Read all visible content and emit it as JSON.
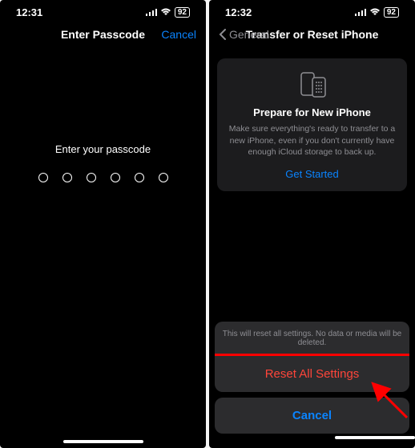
{
  "left": {
    "time": "12:31",
    "battery": "92",
    "title": "Enter Passcode",
    "cancel": "Cancel",
    "prompt": "Enter your passcode"
  },
  "right": {
    "time": "12:32",
    "battery": "92",
    "back": "General",
    "title": "Transfer or Reset iPhone",
    "card": {
      "title": "Prepare for New iPhone",
      "desc": "Make sure everything's ready to transfer to a new iPhone, even if you don't currently have enough iCloud storage to back up.",
      "cta": "Get Started"
    },
    "sheet": {
      "header": "This will reset all settings. No data or media will be deleted.",
      "reset": "Reset All Settings",
      "cancel": "Cancel"
    }
  }
}
